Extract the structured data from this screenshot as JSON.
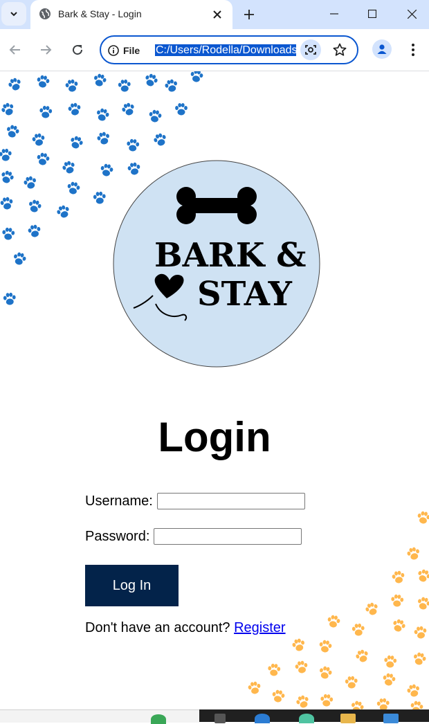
{
  "browser": {
    "tab_title": "Bark & Stay - Login",
    "site_info_label": "File",
    "url": "C:/Users/Rodella/Downloads",
    "accent": "#0b57d0"
  },
  "logo": {
    "line1": "BARK &",
    "line2": "STAY",
    "background": "#cfe2f3"
  },
  "login": {
    "title": "Login",
    "username_label": "Username:",
    "username_value": "",
    "password_label": "Password:",
    "password_value": "",
    "submit_label": "Log In",
    "register_prompt": "Don't have an account?",
    "register_link": "Register",
    "button_color": "#03234a"
  },
  "decor": {
    "paw_blue": "#1e73c8",
    "paw_orange": "#ffb74d"
  }
}
